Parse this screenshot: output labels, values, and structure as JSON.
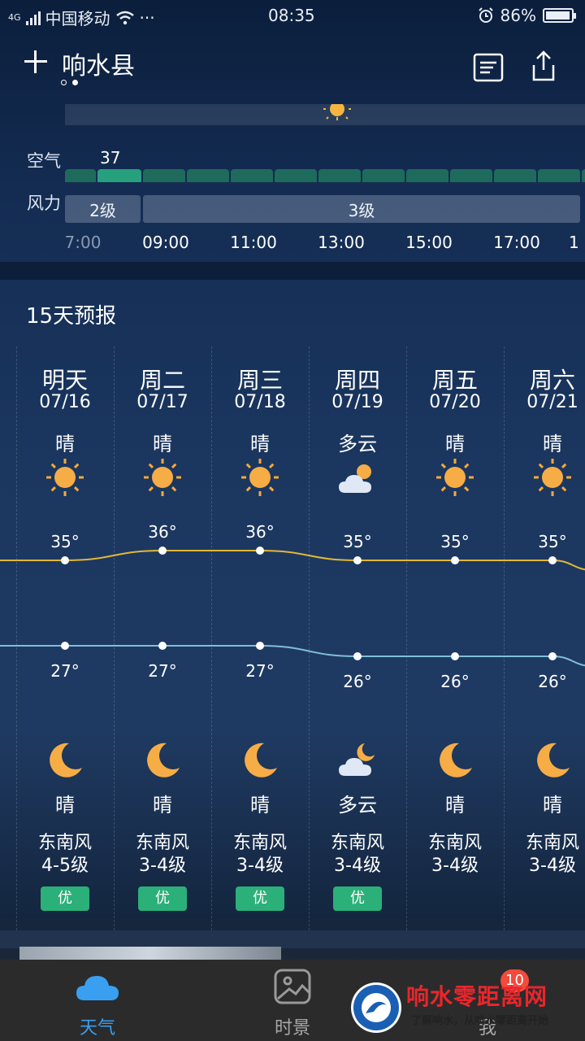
{
  "status_bar": {
    "network": "4G",
    "carrier": "中国移动",
    "more": "···",
    "time": "08:35",
    "battery": "86%"
  },
  "header": {
    "city": "响水县",
    "page_dots": 2,
    "active_dot": 2
  },
  "hourly": {
    "air_label": "空气",
    "aqi_value": "37",
    "wind_label": "风力",
    "wind_segments": [
      "2级",
      "3级"
    ],
    "hours": [
      "7:00",
      "09:00",
      "11:00",
      "13:00",
      "15:00",
      "17:00",
      "1"
    ]
  },
  "forecast": {
    "title": "15天预报",
    "days": [
      {
        "name": "明天",
        "date": "07/16",
        "day_cond": "晴",
        "day_icon": "sun-icon",
        "high": "35°",
        "low": "27°",
        "night_icon": "moon-icon",
        "night_cond": "晴",
        "wind_dir": "东南风",
        "wind_lvl": "4-5级",
        "aq": "优"
      },
      {
        "name": "周二",
        "date": "07/17",
        "day_cond": "晴",
        "day_icon": "sun-icon",
        "high": "36°",
        "low": "27°",
        "night_icon": "moon-icon",
        "night_cond": "晴",
        "wind_dir": "东南风",
        "wind_lvl": "3-4级",
        "aq": "优"
      },
      {
        "name": "周三",
        "date": "07/18",
        "day_cond": "晴",
        "day_icon": "sun-icon",
        "high": "36°",
        "low": "27°",
        "night_icon": "moon-icon",
        "night_cond": "晴",
        "wind_dir": "东南风",
        "wind_lvl": "3-4级",
        "aq": "优"
      },
      {
        "name": "周四",
        "date": "07/19",
        "day_cond": "多云",
        "day_icon": "partly-cloudy-icon",
        "high": "35°",
        "low": "26°",
        "night_icon": "cloudy-night-icon",
        "night_cond": "多云",
        "wind_dir": "东南风",
        "wind_lvl": "3-4级",
        "aq": "优"
      },
      {
        "name": "周五",
        "date": "07/20",
        "day_cond": "晴",
        "day_icon": "sun-icon",
        "high": "35°",
        "low": "26°",
        "night_icon": "moon-icon",
        "night_cond": "晴",
        "wind_dir": "东南风",
        "wind_lvl": "3-4级",
        "aq": ""
      },
      {
        "name": "周六",
        "date": "07/21",
        "day_cond": "晴",
        "day_icon": "sun-icon",
        "high": "35°",
        "low": "26°",
        "night_icon": "moon-icon",
        "night_cond": "晴",
        "wind_dir": "东南风",
        "wind_lvl": "3-4级",
        "aq": ""
      }
    ],
    "high_values": [
      35,
      36,
      36,
      35,
      35,
      35
    ],
    "low_values": [
      27,
      27,
      27,
      26,
      26,
      26
    ]
  },
  "tabbar": {
    "tabs": [
      "天气",
      "时景",
      "我"
    ],
    "active": "天气",
    "badge": "10",
    "active_color": "#3a9ff0"
  },
  "watermark": {
    "title": "响水零距离网",
    "subtitle": "了解响水，从响水零距离开始"
  },
  "colors": {
    "high_line": "#e2b735",
    "low_line": "#7fbfd6",
    "aqi_good": "#2bb07a"
  }
}
